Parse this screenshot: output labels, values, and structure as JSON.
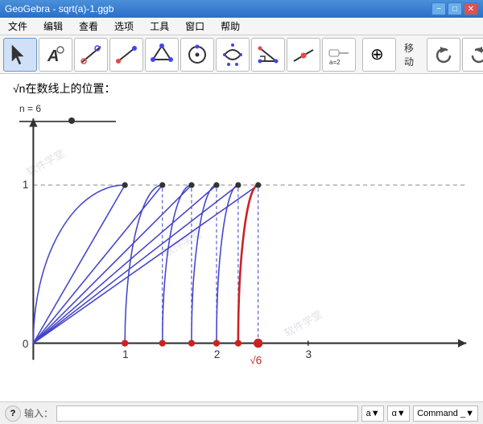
{
  "titlebar": {
    "title": "GeoGebra - sqrt(a)-1.ggb",
    "minimize": "−",
    "maximize": "□",
    "close": "✕"
  },
  "menubar": {
    "items": [
      "文件",
      "编辑",
      "查看",
      "选项",
      "工具",
      "窗口",
      "帮助"
    ]
  },
  "toolbar": {
    "tools": [
      {
        "name": "cursor",
        "label": ""
      },
      {
        "name": "text",
        "label": "A"
      },
      {
        "name": "line",
        "label": ""
      },
      {
        "name": "segment",
        "label": ""
      },
      {
        "name": "polygon",
        "label": ""
      },
      {
        "name": "circle",
        "label": ""
      },
      {
        "name": "conic",
        "label": ""
      },
      {
        "name": "triangle",
        "label": ""
      },
      {
        "name": "point-on-curve",
        "label": ""
      },
      {
        "name": "slider",
        "label": "a=2"
      },
      {
        "name": "move-graphic",
        "label": ""
      },
      {
        "name": "undo",
        "label": ""
      },
      {
        "name": "redo",
        "label": ""
      }
    ],
    "move_label": "移动"
  },
  "canvas": {
    "description": "√n在数线上的位置：",
    "slider_label": "n = 6",
    "graph": {
      "x_axis_label": "0",
      "y_value_1": "1",
      "x_markers": [
        "1",
        "2",
        "3"
      ],
      "sqrt6_label": "√6"
    }
  },
  "statusbar": {
    "help_symbol": "?",
    "input_label": "输入：",
    "alpha_btn": "α",
    "superscript_btn": "a",
    "command_label": "Command _",
    "dropdown_arrow": "▼"
  }
}
